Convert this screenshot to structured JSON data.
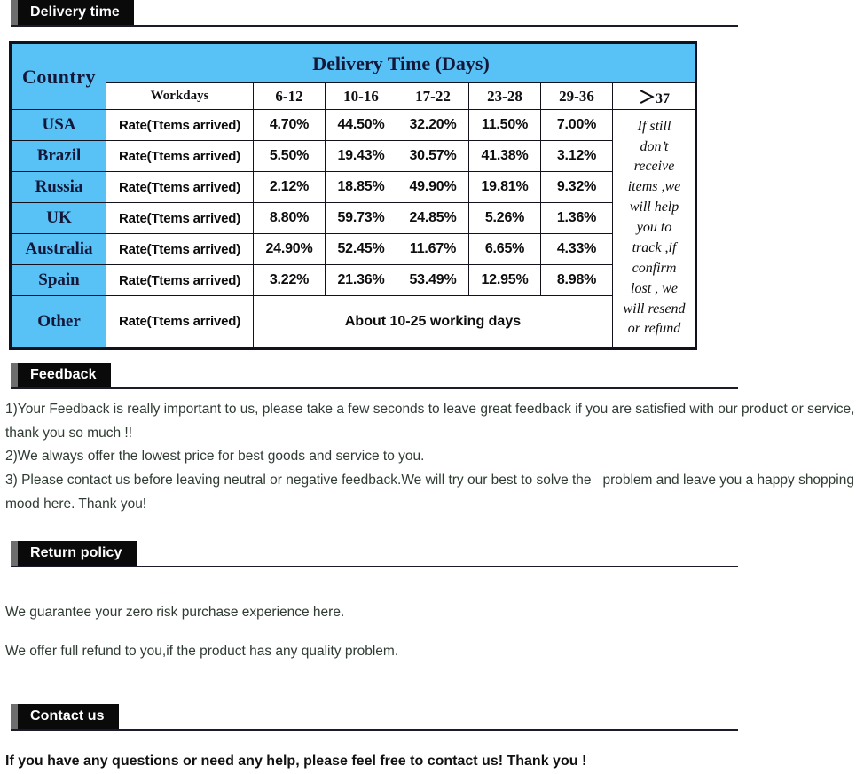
{
  "sections": {
    "delivery": {
      "label": "Delivery time"
    },
    "feedback": {
      "label": "Feedback"
    },
    "return": {
      "label": "Return policy"
    },
    "contact": {
      "label": "Contact us"
    }
  },
  "colors": {
    "header_blue": "#58c1f5",
    "bar_black": "#0a0a0a",
    "bar_grip_gray": "#6e6e6e",
    "country_text_navy": "#13183a",
    "body_text": "#2f3b33"
  },
  "delivery_table": {
    "country_header": "Country",
    "title": "Delivery Time (Days)",
    "subheaders": [
      "Workdays",
      "6-12",
      "10-16",
      "17-22",
      "23-28",
      "29-36"
    ],
    "gt37_prefix": "＞",
    "gt37_suffix": "37",
    "rate_label": "Rate(Ttems arrived)",
    "note": "If still don’t receive items ,we will help you to track ,if confirm lost , we will resend or refund",
    "note_lines": [
      "If still",
      "don’t",
      "receive",
      "items ,we",
      "will help",
      "you to",
      "track ,if",
      "confirm",
      "lost , we",
      "will resend",
      "or refund"
    ],
    "rows": [
      {
        "country": "USA",
        "label": "Rate(Ttems arrived)",
        "values": [
          "4.70%",
          "44.50%",
          "32.20%",
          "11.50%",
          "7.00%"
        ]
      },
      {
        "country": "Brazil",
        "label": "Rate(Ttems arrived)",
        "values": [
          "5.50%",
          "19.43%",
          "30.57%",
          "41.38%",
          "3.12%"
        ]
      },
      {
        "country": "Russia",
        "label": "Rate(Ttems arrived)",
        "values": [
          "2.12%",
          "18.85%",
          "49.90%",
          "19.81%",
          "9.32%"
        ]
      },
      {
        "country": "UK",
        "label": "Rate(Ttems arrived)",
        "values": [
          "8.80%",
          "59.73%",
          "24.85%",
          "5.26%",
          "1.36%"
        ]
      },
      {
        "country": "Australia",
        "label": "Rate(Ttems arrived)",
        "values": [
          "24.90%",
          "52.45%",
          "11.67%",
          "6.65%",
          "4.33%"
        ]
      },
      {
        "country": "Spain",
        "label": "Rate(Ttems arrived)",
        "values": [
          "3.22%",
          "21.36%",
          "53.49%",
          "12.95%",
          "8.98%"
        ]
      }
    ],
    "other_row": {
      "country": "Other",
      "label": "Rate(Ttems arrived)",
      "note": "About 10-25 working days"
    }
  },
  "feedback": {
    "lines": [
      "1)Your Feedback is really important to us, please take a few seconds to leave great feedback if you are satisfied with our product or service, thank you so much !!",
      "2)We always offer the lowest price for best goods and service to you.",
      "3) Please contact us before leaving neutral or negative feedback.We will try our best to solve the   problem and leave you a happy shopping mood here. Thank you!"
    ]
  },
  "return_policy": {
    "lines": [
      "We guarantee your zero risk purchase experience here.",
      "We offer full refund to you,if the product has any quality problem."
    ]
  },
  "contact": {
    "text": "If you have any questions or need any help, please feel free to contact us! Thank you !"
  }
}
